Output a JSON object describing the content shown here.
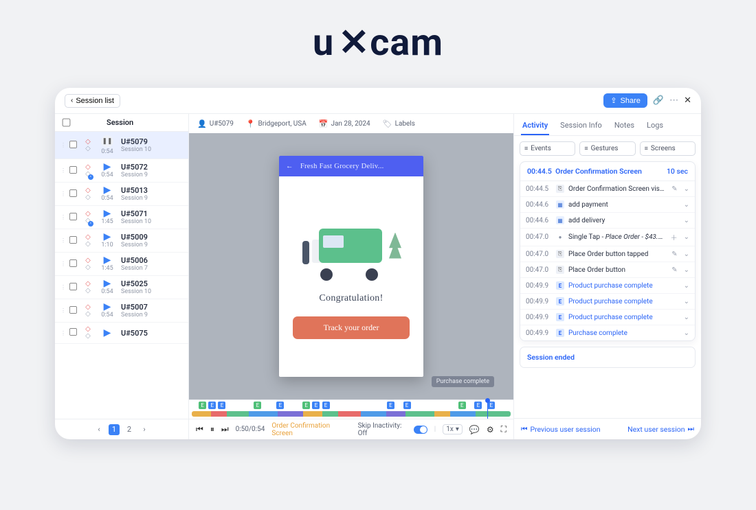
{
  "brand": "uxcam",
  "header": {
    "back_label": "Session list",
    "share_label": "Share"
  },
  "left": {
    "column_title": "Session",
    "pages": [
      "1",
      "2"
    ]
  },
  "sessions": [
    {
      "id": "U#5079",
      "sub": "Session 10",
      "dur": "0:54",
      "active": true
    },
    {
      "id": "U#5072",
      "sub": "Session 9",
      "dur": "0:54",
      "badge": true
    },
    {
      "id": "U#5013",
      "sub": "Session 9",
      "dur": "0:54"
    },
    {
      "id": "U#5071",
      "sub": "Session 10",
      "dur": "1:45",
      "badge": true
    },
    {
      "id": "U#5009",
      "sub": "Session 9",
      "dur": "1:10"
    },
    {
      "id": "U#5006",
      "sub": "Session 7",
      "dur": "1:45"
    },
    {
      "id": "U#5025",
      "sub": "Session 10",
      "dur": "0:54"
    },
    {
      "id": "U#5007",
      "sub": "Session 9",
      "dur": "0:54"
    },
    {
      "id": "U#5075",
      "sub": "",
      "dur": ""
    }
  ],
  "meta": {
    "user": "U#5079",
    "location": "Bridgeport, USA",
    "date": "Jan 28, 2024",
    "labels": "Labels"
  },
  "phone": {
    "app_title": "Fresh Fast Grocery Deliv...",
    "headline": "Congratulation!",
    "track": "Track your order",
    "tooltip": "Purchase complete"
  },
  "player": {
    "time": "0:50/0:54",
    "screen": "Order Confirmation Screen",
    "skip_label": "Skip Inactivity: Off",
    "speed": "1x"
  },
  "tabs": {
    "activity": "Activity",
    "info": "Session Info",
    "notes": "Notes",
    "logs": "Logs"
  },
  "filters": {
    "events": "Events",
    "gestures": "Gestures",
    "screens": "Screens"
  },
  "activity": {
    "head_ts": "00:44.5",
    "head_title": "Order Confirmation Screen",
    "head_dur": "10 sec",
    "rows": [
      {
        "ts": "00:44.5",
        "icon": "nav",
        "text": "Order Confirmation Screen visited",
        "edit": true
      },
      {
        "ts": "00:44.6",
        "icon": "db",
        "text": "add payment"
      },
      {
        "ts": "00:44.6",
        "icon": "db",
        "text": "add delivery"
      },
      {
        "ts": "00:47.0",
        "icon": "dot",
        "text": "Single Tap - Place Order - $43.3...",
        "italic": true,
        "plus": true
      },
      {
        "ts": "00:47.0",
        "icon": "nav",
        "text": "Place Order button tapped",
        "edit": true
      },
      {
        "ts": "00:47.0",
        "icon": "nav",
        "text": "Place Order button",
        "edit": true
      },
      {
        "ts": "00:49.9",
        "icon": "evt",
        "text": "Product purchase complete",
        "link": true
      },
      {
        "ts": "00:49.9",
        "icon": "evt",
        "text": "Product purchase complete",
        "link": true
      },
      {
        "ts": "00:49.9",
        "icon": "evt",
        "text": "Product purchase complete",
        "link": true
      },
      {
        "ts": "00:49.9",
        "icon": "evt",
        "text": "Purchase complete",
        "link": true
      }
    ],
    "ended": "Session ended",
    "prev": "Previous user session",
    "next": "Next user session"
  }
}
